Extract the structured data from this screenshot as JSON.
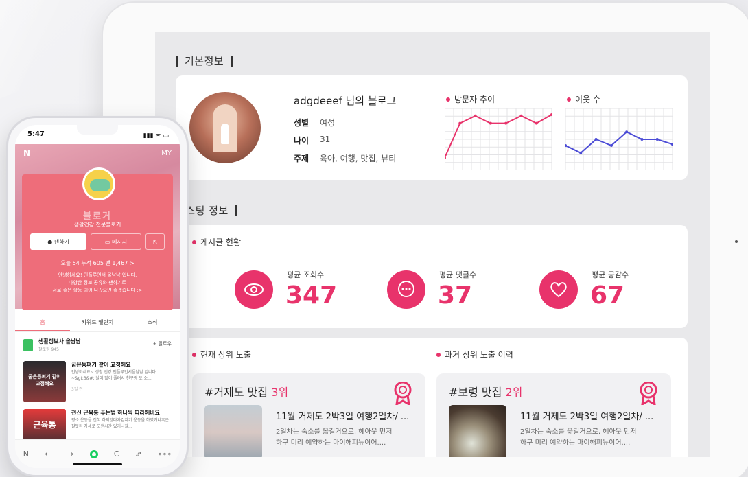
{
  "tablet": {
    "basic_info": {
      "section_label": "기본정보",
      "blog_name": "adgdeeef 님의 블로그",
      "fields": [
        {
          "key": "성별",
          "value": "여성"
        },
        {
          "key": "나이",
          "value": "31"
        },
        {
          "key": "주제",
          "value": "육아, 여행, 맛집, 뷰티"
        }
      ],
      "visitor_trend_label": "방문자 추이",
      "neighbors_label": "이웃 수"
    },
    "posting_info": {
      "section_label": "포스팅 정보",
      "status_label": "게시글 현황",
      "stats": [
        {
          "name": "평균 조회수",
          "value": "347",
          "icon": "eye-icon"
        },
        {
          "name": "평균 댓글수",
          "value": "37",
          "icon": "chat-bubble-icon"
        },
        {
          "name": "평균 공감수",
          "value": "67",
          "icon": "heart-icon"
        }
      ]
    },
    "exposure": {
      "current_label": "현재 상위 노출",
      "past_label": "과거 상위 노출 이력",
      "cards": [
        {
          "keyword": "#거제도 맛집",
          "rank": "3위",
          "post_title": "11월 거제도 2박3일 여행2일차/ ...",
          "desc_line1": "2일차는 숙소를 옮길거으로, 혜아웃 먼저",
          "desc_line2": "하구 미리 예약하는 마이해피뉴이어....",
          "badge_icon": "award-icon"
        },
        {
          "keyword": "#보령 맛집",
          "rank": "2위",
          "post_title": "11월 거제도 2박3일 여행2일차/ ...",
          "desc_line1": "2일차는 숙소를 옮길거으로, 혜아웃 먼저",
          "desc_line2": "하구 미리 예약하는 마이해피뉴이어....",
          "badge_icon": "award-icon"
        }
      ]
    }
  },
  "phone": {
    "status_time": "5:47",
    "status_icons": "▮▮▮ ᯤ ▭",
    "cover_logo": "N",
    "cover_my": "MY",
    "nickname": "블로거",
    "role": "생활건강 전문블로거",
    "follow_button": "● 팬하기",
    "message_button": "▭ 메시지",
    "share_icon": "share-icon",
    "stats_line": "오늘 54   누적 605   팬 1,467  >",
    "intro_line1": "안녕하세요! 인플루언서 올남남 입니다.",
    "intro_line2": "다양한 정보 공유와 팬하기로",
    "intro_line3": "서로 좋은 활동 이어 나갔으면 좋겠습니다 :>",
    "tabs": [
      "홈",
      "키워드 챌린지",
      "소식"
    ],
    "notice": {
      "name": "생활정보사 올남남",
      "sub": "팔로워 945",
      "follow": "+ 팔로우"
    },
    "posts": [
      {
        "thumb_label": "굽은등펴기 같이 교정해요",
        "title": "굽은등펴기 같이 교정해요",
        "desc": "안녕하세요~ 생활 건강 인플루언서올남남 입니다~&gt;3&#; 날이 많이 풀려서 친구랑 또 소...",
        "meta": "3일 전"
      },
      {
        "thumb_label": "근육통",
        "title": "전신 근육통 푸는법 하나씩 따라해비요",
        "desc": "평소 운동을 전혀 하지않다가갑자기 운동을 하였거나혹은 잘못된 자세로 오랜시간 있거나잘...",
        "meta": ""
      }
    ],
    "bottom_bar": [
      "N",
      "←",
      "→",
      "home",
      "C",
      "⇗",
      "∘∘∘"
    ]
  },
  "colors": {
    "accent": "#e8336b",
    "phone_card": "#ee6d7a",
    "visitor_line": "#e8336b",
    "neighbor_line": "#4b4bd6"
  },
  "chart_data": [
    {
      "type": "line",
      "title": "방문자 추이",
      "values": [
        10,
        38,
        44,
        38,
        38,
        44,
        38,
        45
      ]
    },
    {
      "type": "line",
      "title": "이웃 수",
      "values": [
        20,
        14,
        25,
        20,
        31,
        25,
        25,
        21
      ]
    }
  ]
}
